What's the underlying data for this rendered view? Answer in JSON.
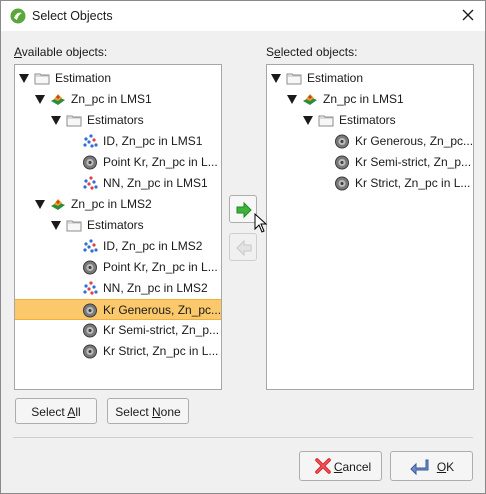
{
  "window": {
    "title": "Select Objects",
    "icon": "leapfrog-app-icon"
  },
  "available": {
    "label_prefix": "",
    "label_underline": "A",
    "label_rest": "vailable objects:",
    "tree": [
      {
        "label": "Estimation",
        "icon": "folder-icon",
        "expanded": true
      },
      {
        "label": "Zn_pc in LMS1",
        "icon": "domain-surface-icon",
        "expanded": true
      },
      {
        "label": "Estimators",
        "icon": "folder-icon",
        "expanded": true
      },
      {
        "label": "ID, Zn_pc in LMS1",
        "icon": "inverse-distance-icon"
      },
      {
        "label": "Point Kr, Zn_pc in L...",
        "icon": "kriging-icon"
      },
      {
        "label": "NN, Zn_pc in LMS1",
        "icon": "nearest-neighbour-icon"
      },
      {
        "label": "Zn_pc in LMS2",
        "icon": "domain-surface-icon",
        "expanded": true
      },
      {
        "label": "Estimators",
        "icon": "folder-icon",
        "expanded": true
      },
      {
        "label": "ID, Zn_pc in LMS2",
        "icon": "inverse-distance-icon"
      },
      {
        "label": "Point Kr, Zn_pc in L...",
        "icon": "kriging-icon"
      },
      {
        "label": "NN, Zn_pc in LMS2",
        "icon": "nearest-neighbour-icon"
      },
      {
        "label": "Kr Generous, Zn_pc...",
        "icon": "kriging-icon",
        "selected": true
      },
      {
        "label": "Kr Semi-strict, Zn_p...",
        "icon": "kriging-icon"
      },
      {
        "label": "Kr Strict, Zn_pc in L...",
        "icon": "kriging-icon"
      }
    ]
  },
  "selected": {
    "label_prefix": "S",
    "label_underline": "e",
    "label_rest": "lected objects:",
    "tree": [
      {
        "label": "Estimation",
        "icon": "folder-icon",
        "expanded": true
      },
      {
        "label": "Zn_pc in LMS1",
        "icon": "domain-surface-icon",
        "expanded": true
      },
      {
        "label": "Estimators",
        "icon": "folder-icon",
        "expanded": true
      },
      {
        "label": "Kr Generous, Zn_pc...",
        "icon": "kriging-icon"
      },
      {
        "label": "Kr Semi-strict, Zn_p...",
        "icon": "kriging-icon"
      },
      {
        "label": "Kr Strict, Zn_pc in L...",
        "icon": "kriging-icon"
      }
    ]
  },
  "buttons": {
    "select_all_prefix": "Select ",
    "select_all_underline": "A",
    "select_all_rest": "ll",
    "select_none_prefix": "Select ",
    "select_none_underline": "N",
    "select_none_rest": "one",
    "cancel_underline": "C",
    "cancel_rest": "ancel",
    "ok_underline": "O",
    "ok_rest": "K"
  },
  "colors": {
    "selection": "#fbc96b",
    "add_arrow": "#3cb43c",
    "cancel_icon": "#d9262b"
  }
}
